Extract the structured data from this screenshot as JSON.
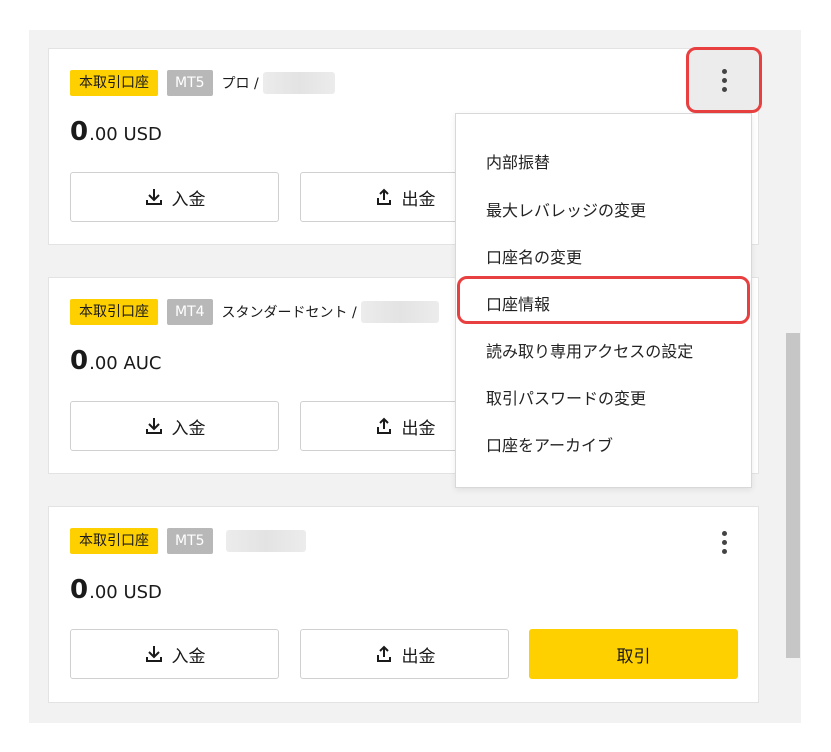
{
  "accounts": [
    {
      "tag": "本取引口座",
      "platform": "MT5",
      "type": "プロ /",
      "balance_int": "0",
      "balance_rest": ".00 USD",
      "deposit_label": "入金",
      "withdraw_label": "出金"
    },
    {
      "tag": "本取引口座",
      "platform": "MT4",
      "type": "スタンダードセント /",
      "balance_int": "0",
      "balance_rest": ".00 AUC",
      "deposit_label": "入金",
      "withdraw_label": "出金"
    },
    {
      "tag": "本取引口座",
      "platform": "MT5",
      "type": "",
      "balance_int": "0",
      "balance_rest": ".00 USD",
      "deposit_label": "入金",
      "withdraw_label": "出金",
      "trade_label": "取引"
    }
  ],
  "menu": {
    "items": [
      "内部振替",
      "最大レバレッジの変更",
      "口座名の変更",
      "口座情報",
      "読み取り専用アクセスの設定",
      "取引パスワードの変更",
      "口座をアーカイブ"
    ],
    "highlighted": "口座情報"
  },
  "colors": {
    "accent_yellow": "#ffd000",
    "tag_gray": "#b8b8b8",
    "highlight_red": "#e84040"
  },
  "icons": {
    "deposit": "download-icon",
    "withdraw": "upload-icon",
    "more": "more-vertical-icon"
  }
}
